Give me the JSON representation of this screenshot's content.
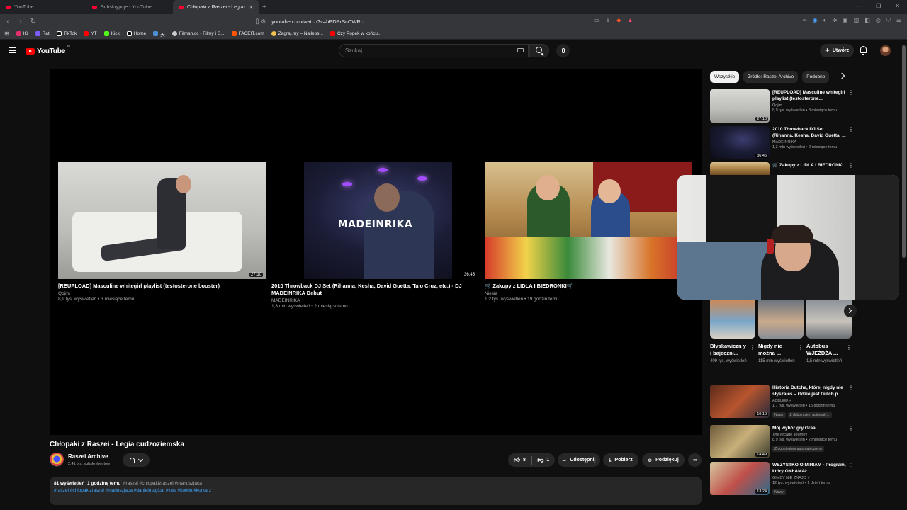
{
  "browser": {
    "tabs": [
      {
        "title": "YouTube",
        "active": false
      },
      {
        "title": "Subskrypcje - YouTube",
        "active": false
      },
      {
        "title": "Chłopaki z Raszei - Legia cudzo...",
        "active": true
      }
    ],
    "url": "youtube.com/watch?v=bPDPrScCWRc",
    "bookmarks": [
      {
        "label": "IG",
        "color": "#e1306c"
      },
      {
        "label": "Rat",
        "color": "#7b5cff"
      },
      {
        "label": "TikTok",
        "color": "#ffffff"
      },
      {
        "label": "YT",
        "color": "#ff0000"
      },
      {
        "label": "Kick",
        "color": "#53fc18"
      },
      {
        "label": "Home",
        "color": "#ffffff"
      },
      {
        "label": "天",
        "color": "#4a90d9"
      },
      {
        "label": "Filman.cc - Filmy i S...",
        "color": "#cccccc"
      },
      {
        "label": "FACEIT.com",
        "color": "#ff5500"
      },
      {
        "label": "Zagraj.my – Najleps...",
        "color": "#f2c14e"
      },
      {
        "label": "Czy Popek w końcu...",
        "color": "#ff0000"
      }
    ]
  },
  "header": {
    "logo": "YouTube",
    "country": "PL",
    "search_placeholder": "Szukaj",
    "create_label": "Utwórz"
  },
  "player": {
    "endcards": [
      {
        "title": "[REUPLOAD] Masculine whitegirl playlist (testosterone booster)",
        "channel": "Qojim",
        "meta": "8,9 tys. wyświetleń • 3 miesiące temu",
        "duration": "27:10"
      },
      {
        "title": "2010 Throwback DJ Set (Rihanna, Kesha, David Guetta, Taio Cruz, etc.) - DJ MADEINRIKA Debut",
        "channel": "MADEINRIKA",
        "meta": "1,3 mln wyświetleń • 2 miesiące temu",
        "duration": "36:45",
        "brand": "MADEINRIKA"
      },
      {
        "title": "🛒 Zakupy z LIDLA I BIEDRONKI🛒",
        "channel": "Niesia",
        "meta": "1,2 tys. wyświetleń • 19 godzin temu",
        "duration": ""
      }
    ]
  },
  "video": {
    "title": "Chłopaki z Raszei - Legia cudzoziemska",
    "channel": "Raszei Archive",
    "subscribers": "2,41 tys. subskrybentów",
    "likes": "8",
    "dislikes": "1",
    "share_label": "Udostępnij",
    "download_label": "Pobierz",
    "thanks_label": "Podziękuj",
    "views": "81 wyświetleń",
    "time_ago": "1 godzinę temu",
    "tags_line1": "#raszei #chłopakizraszei #mariuszjaca",
    "tags_line2": "#raszei #chłopakizraszei #mariuszjaca #danielmagical #kws #korkin #korkarz"
  },
  "sidebar": {
    "chips": [
      "Wszystkie",
      "Źródło: Raszei Archive",
      "Podobne"
    ],
    "recs_top": [
      {
        "title": "[REUPLOAD] Masculine whitegirl playlist (testosterone...",
        "channel": "Qojim",
        "meta": "8,9 tys. wyświetleń • 3 miesiące temu",
        "duration": "27:10"
      },
      {
        "title": "2010 Throwback DJ Set (Rihanna, Kesha, David Guetta, ...",
        "channel": "MADEINRIKA",
        "meta": "1,3 mln wyświetleń • 2 miesiące temu",
        "duration": "36:45"
      },
      {
        "title": "🛒 Zakupy z LIDLA I BIEDRONKI",
        "channel": "",
        "meta": "",
        "duration": ""
      }
    ],
    "shorts": [
      {
        "title": "Błyskawiczn y i bajeczni...",
        "views": "409 tys. wyświetleń"
      },
      {
        "title": "Nigdy nie można ...",
        "views": "115 mln wyświetleń"
      },
      {
        "title": "Autobus WJEŻDŻA ...",
        "views": "1,5 mln wyświetleń"
      }
    ],
    "recs_bottom": [
      {
        "title": "Historia Dutcha, której nigdy nie słyszałeś – Gdzie jest Dutch p...",
        "channel": "Acid0low ✓",
        "meta": "1,7 tys. wyświetleń • 15 godzin temu",
        "badge1": "Nowy",
        "badge2": "Z dubbingiem automaty...",
        "duration": "10:10"
      },
      {
        "title": "Mój wybór gry Graal",
        "channel": "The Arcade Journey",
        "meta": "8,9 tys. wyświetleń • 2 miesiące temu",
        "badge1": "",
        "badge2": "Z dubbingiem automatycznym",
        "duration": "14:49"
      },
      {
        "title": "WSZYSTKO O MIRIAM - Program, który OKŁAMAŁ ...",
        "channel": "GIMBY NIE ZNAJO ✓",
        "meta": "12 tys. wyświetleń • 1 dzień temu",
        "badge1": "Nowy",
        "badge2": "",
        "duration": "13:24"
      }
    ]
  }
}
